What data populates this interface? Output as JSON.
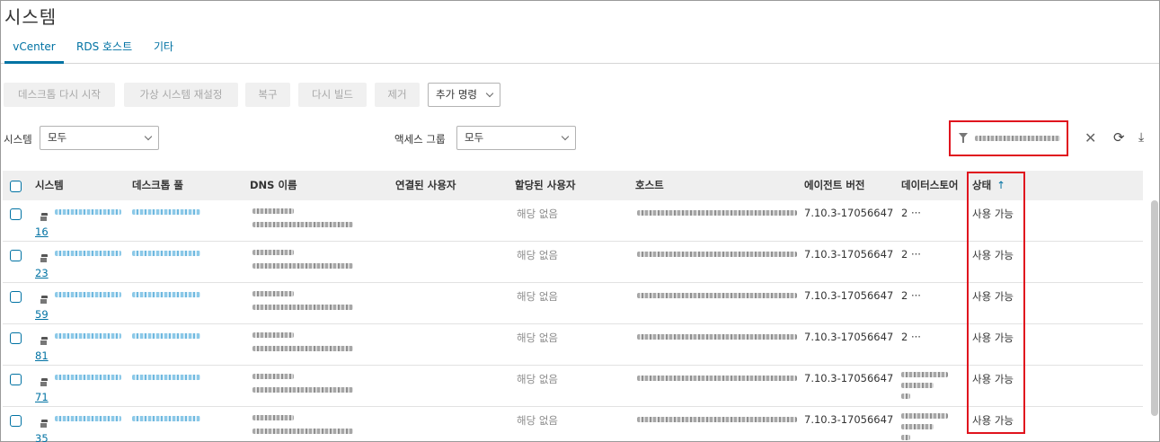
{
  "page": {
    "title": "시스템"
  },
  "tabs": [
    {
      "label": "vCenter",
      "active": true
    },
    {
      "label": "RDS 호스트",
      "active": false
    },
    {
      "label": "기타",
      "active": false
    }
  ],
  "toolbar": {
    "restart_desktop": "데스크톱 다시 시작",
    "reset_vm": "가상 시스템 재설정",
    "recover": "복구",
    "rebuild": "다시 빌드",
    "remove": "제거",
    "more_commands": "추가 명령"
  },
  "filters": {
    "system_label": "시스템",
    "system_value": "모두",
    "access_group_label": "액세스 그룹",
    "access_group_value": "모두"
  },
  "columns": {
    "system": "시스템",
    "desktop_pool": "데스크톱 풀",
    "dns_name": "DNS 이름",
    "connected_user": "연결된 사용자",
    "assigned_user": "할당된 사용자",
    "host": "호스트",
    "agent_version": "에이전트 버전",
    "datastore": "데이터스토어",
    "status": "상태"
  },
  "icons": {
    "filter": "filter-icon",
    "clear": "close-icon",
    "refresh": "refresh-icon",
    "download": "download-icon",
    "sort": "sort-ascending-icon",
    "vm": "virtual-machine-icon"
  },
  "colors": {
    "accent": "#0072a3",
    "highlight": "#e0141e"
  },
  "rows": [
    {
      "num": "16",
      "assigned_user": "해당 없음",
      "agent_version": "7.10.3-17056647",
      "datastore": "2 ···",
      "status": "사용 가능"
    },
    {
      "num": "23",
      "assigned_user": "해당 없음",
      "agent_version": "7.10.3-17056647",
      "datastore": "2 ···",
      "status": "사용 가능"
    },
    {
      "num": "59",
      "assigned_user": "해당 없음",
      "agent_version": "7.10.3-17056647",
      "datastore": "2 ···",
      "status": "사용 가능"
    },
    {
      "num": "81",
      "assigned_user": "해당 없음",
      "agent_version": "7.10.3-17056647",
      "datastore": "2 ···",
      "status": "사용 가능"
    },
    {
      "num": "71",
      "assigned_user": "해당 없음",
      "agent_version": "7.10.3-17056647",
      "datastore": "",
      "status": "사용 가능"
    },
    {
      "num": "35",
      "assigned_user": "해당 없음",
      "agent_version": "7.10.3-17056647",
      "datastore": "",
      "status": "사용 가능"
    }
  ]
}
